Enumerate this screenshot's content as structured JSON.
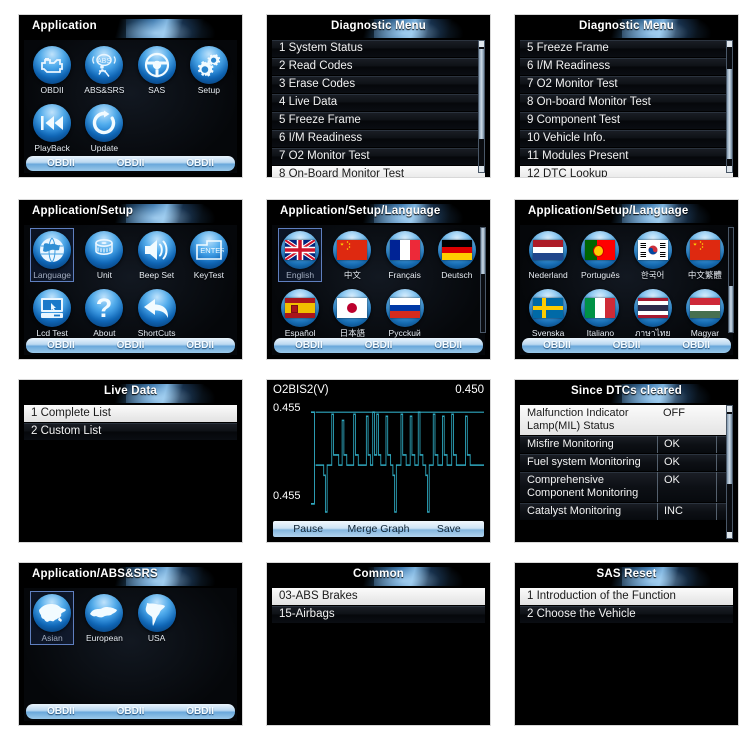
{
  "panels": {
    "application": {
      "title": "Application",
      "icons": [
        {
          "label": "OBDII",
          "icon": "engine-icon"
        },
        {
          "label": "ABS&SRS",
          "icon": "abs-srs-icon"
        },
        {
          "label": "SAS",
          "icon": "steering-wheel-icon"
        },
        {
          "label": "Setup",
          "icon": "gears-icon"
        },
        {
          "label": "PlayBack",
          "icon": "rewind-icon"
        },
        {
          "label": "Update",
          "icon": "refresh-icon"
        }
      ],
      "bottom_bar": [
        "OBDII",
        "OBDII",
        "OBDII"
      ]
    },
    "diag_menu_1": {
      "title": "Diagnostic Menu",
      "items": [
        {
          "label": "1 System Status",
          "selected": false
        },
        {
          "label": "2 Read Codes",
          "selected": false
        },
        {
          "label": "3 Erase Codes",
          "selected": false
        },
        {
          "label": "4 Live  Data",
          "selected": false
        },
        {
          "label": "5 Freeze Frame",
          "selected": false
        },
        {
          "label": "6 I/M Readiness",
          "selected": false
        },
        {
          "label": "7 O2 Monitor  Test",
          "selected": false
        },
        {
          "label": "8 On-Board Monitor Test",
          "selected": true
        }
      ]
    },
    "diag_menu_2": {
      "title": "Diagnostic Menu",
      "items": [
        {
          "label": "5 Freeze Frame",
          "selected": false
        },
        {
          "label": "6 I/M Readiness",
          "selected": false
        },
        {
          "label": "7 O2 Monitor  Test",
          "selected": false
        },
        {
          "label": "8 On-board Monitor Test",
          "selected": false
        },
        {
          "label": "9 Component Test",
          "selected": false
        },
        {
          "label": "10 Vehicle Info.",
          "selected": false
        },
        {
          "label": "11 Modules Present",
          "selected": false
        },
        {
          "label": "12 DTC Lookup",
          "selected": true
        }
      ]
    },
    "setup": {
      "title": "Application/Setup",
      "icons": [
        {
          "label": "Language",
          "icon": "globe-icon",
          "selected": true
        },
        {
          "label": "Unit",
          "icon": "measuring-tape-icon",
          "selected": false
        },
        {
          "label": "Beep Set",
          "icon": "speaker-icon",
          "selected": false
        },
        {
          "label": "KeyTest",
          "icon": "enter-key-icon",
          "selected": false
        },
        {
          "label": "Lcd Test",
          "icon": "monitor-icon",
          "selected": false
        },
        {
          "label": "About",
          "icon": "question-mark-icon",
          "selected": false
        },
        {
          "label": "ShortCuts",
          "icon": "back-arrow-icon",
          "selected": false
        }
      ],
      "bottom_bar": [
        "OBDII",
        "OBDII",
        "OBDII"
      ]
    },
    "language_1": {
      "title": "Application/Setup/Language",
      "icons": [
        {
          "label": "English",
          "icon": "flag-uk-icon",
          "selected": true
        },
        {
          "label": "中文",
          "icon": "flag-china-icon",
          "selected": false
        },
        {
          "label": "Français",
          "icon": "flag-france-icon",
          "selected": false
        },
        {
          "label": "Deutsch",
          "icon": "flag-germany-icon",
          "selected": false
        },
        {
          "label": "Español",
          "icon": "flag-spain-icon",
          "selected": false
        },
        {
          "label": "日本語",
          "icon": "flag-japan-icon",
          "selected": false
        },
        {
          "label": "Pуcckuй",
          "icon": "flag-russia-icon",
          "selected": false
        }
      ],
      "bottom_bar": [
        "OBDII",
        "OBDII",
        "OBDII"
      ]
    },
    "language_2": {
      "title": "Application/Setup/Language",
      "icons": [
        {
          "label": "Nederland",
          "icon": "flag-netherlands-icon",
          "selected": false
        },
        {
          "label": "Português",
          "icon": "flag-portugal-icon",
          "selected": false
        },
        {
          "label": "한국어",
          "icon": "flag-korea-icon",
          "selected": false
        },
        {
          "label": "中文繁體",
          "icon": "flag-china-icon",
          "selected": false
        },
        {
          "label": "Svenska",
          "icon": "flag-sweden-icon",
          "selected": false
        },
        {
          "label": "Italiano",
          "icon": "flag-italy-icon",
          "selected": false
        },
        {
          "label": "ภาษาไทย",
          "icon": "flag-thailand-icon",
          "selected": false
        },
        {
          "label": "Magyar",
          "icon": "flag-hungary-icon",
          "selected": false
        }
      ],
      "bottom_bar": [
        "OBDII",
        "OBDII",
        "OBDII"
      ]
    },
    "live_data": {
      "title": "Live Data",
      "items": [
        {
          "label": "1 Complete List",
          "selected": true
        },
        {
          "label": "2 Custom List",
          "selected": false
        }
      ]
    },
    "graph": {
      "pid_label": "O2BIS2(V)",
      "value": "0.450",
      "y_max": "0.455",
      "y_min": "0.455",
      "buttons": [
        "Pause",
        "Merge Graph",
        "Save"
      ],
      "trace_color": "#2fa8bf"
    },
    "dtc_status": {
      "title": "Since DTCs cleared",
      "rows": [
        {
          "name": "Malfunction Indicator Lamp(MIL) Status",
          "value": "OFF",
          "selected": true
        },
        {
          "name": "Misfire Monitoring",
          "value": "OK",
          "selected": false
        },
        {
          "name": "Fuel system Monitoring",
          "value": "OK",
          "selected": false
        },
        {
          "name": "Comprehensive Component Monitoring",
          "value": "OK",
          "selected": false
        },
        {
          "name": "Catalyst Monitoring",
          "value": "INC",
          "selected": false
        }
      ]
    },
    "abs_srs": {
      "title": "Application/ABS&SRS",
      "icons": [
        {
          "label": "Asian",
          "icon": "map-asia-icon",
          "selected": true
        },
        {
          "label": "European",
          "icon": "map-europe-icon",
          "selected": false
        },
        {
          "label": "USA",
          "icon": "map-usa-icon",
          "selected": false
        }
      ],
      "bottom_bar": [
        "OBDII",
        "OBDII",
        "OBDII"
      ]
    },
    "common": {
      "title": "Common",
      "items": [
        {
          "label": "03-ABS Brakes",
          "selected": true
        },
        {
          "label": "15-Airbags",
          "selected": false
        }
      ]
    },
    "sas_reset": {
      "title": "SAS Reset",
      "items": [
        {
          "label": "1 Introduction of the Function",
          "selected": true
        },
        {
          "label": "2 Choose the Vehicle",
          "selected": false
        }
      ]
    }
  },
  "chart_data": {
    "type": "line",
    "title": "O2BIS2(V)",
    "xlabel": "",
    "ylabel": "V",
    "ylim": [
      0.455,
      0.455
    ],
    "current_value": 0.45,
    "series": [
      {
        "name": "O2BIS2",
        "color": "#2fa8bf",
        "values": [
          0.46,
          0.46,
          0.46,
          0.46,
          0.46,
          0.46,
          0.46,
          0.46,
          0.2,
          0.46,
          0.46,
          0.46,
          0.95,
          0.52,
          0.52,
          0.95,
          0.52,
          0.52,
          0.95,
          0.52,
          0.52,
          0.52,
          0.52,
          0.95,
          0.52,
          0.95,
          0.95,
          0.52,
          0.52,
          0.52,
          0.2,
          0.52,
          0.95,
          0.52,
          0.52,
          0.95,
          0.52,
          0.52,
          0.95,
          0.52,
          0.2,
          0.52,
          0.95,
          0.52,
          0.52,
          0.52,
          0.52,
          0.95,
          0.52,
          0.52,
          0.52
        ]
      }
    ]
  }
}
